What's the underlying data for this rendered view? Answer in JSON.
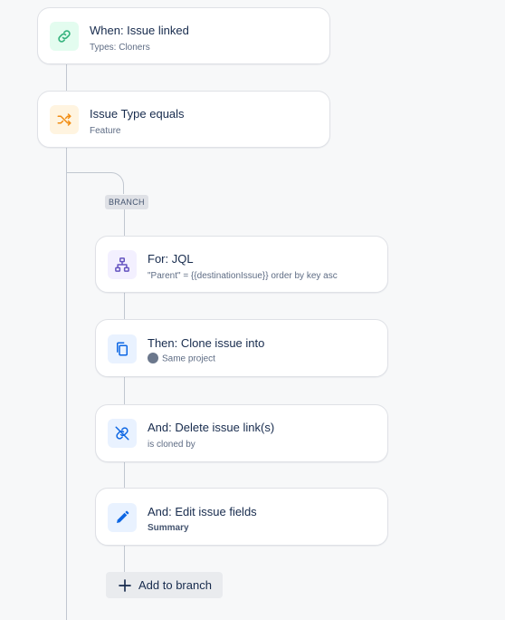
{
  "colors": {
    "trigger_bg": "#e3fcef",
    "trigger_fg": "#36b37e",
    "condition_bg": "#fff4e0",
    "condition_fg": "#f18d13",
    "branch_bg": "#f3f0ff",
    "branch_fg": "#6554c0",
    "action_bg": "#e9f2ff",
    "action_fg": "#0c66e4"
  },
  "trigger": {
    "title": "When: Issue linked",
    "subtitle": "Types: Cloners",
    "icon": "link-icon"
  },
  "condition": {
    "title": "Issue Type equals",
    "subtitle": "Feature",
    "icon": "shuffle-icon"
  },
  "branch": {
    "tag": "BRANCH",
    "steps": [
      {
        "title": "For: JQL",
        "subtitle": "\"Parent\" = {{destinationIssue}} order by key asc",
        "icon": "hierarchy-icon"
      },
      {
        "title": "Then: Clone issue into",
        "subtitle": "Same project",
        "icon": "copy-icon"
      },
      {
        "title": "And: Delete issue link(s)",
        "subtitle": "is cloned by",
        "icon": "unlink-icon"
      },
      {
        "title": "And: Edit issue fields",
        "subtitle": "Summary",
        "icon": "pencil-icon"
      }
    ],
    "add_label": "Add to branch"
  }
}
